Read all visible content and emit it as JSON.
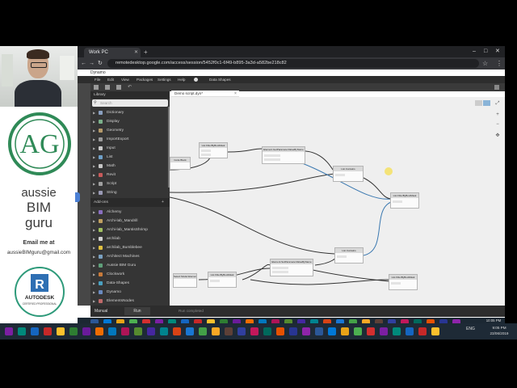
{
  "presenter": {
    "brand_line1": "aussie",
    "brand_line2": "BIM",
    "brand_line3": "guru",
    "email_label": "Email me at",
    "email": "aussieBIMguru@gmail.com",
    "logo_text": "AG",
    "badge_letter": "R",
    "badge_text1": "AUTODESK",
    "badge_text2": "CERTIFIED PROFESSIONAL"
  },
  "browser": {
    "tab_title": "Work PC",
    "url": "remotedesktop.google.com/access/session/5452f0c1-6f49-b895-3a3d-a582be218c82",
    "new_tab_symbol": "+",
    "minimize_symbol": "–",
    "maximize_symbol": "□",
    "close_symbol": "✕"
  },
  "dynamo": {
    "title": "Dynamo",
    "menu": [
      "File",
      "Edit",
      "View",
      "Packages",
      "Settings",
      "Help",
      "Data Shapes"
    ],
    "library_title": "Library",
    "workspace_tab": "Demo script.dyn*",
    "search_placeholder": "Search",
    "library_items": [
      {
        "label": "Dictionary",
        "color": "#8aa0c0"
      },
      {
        "label": "Display",
        "color": "#7bb08a"
      },
      {
        "label": "Geometry",
        "color": "#b59a6a"
      },
      {
        "label": "ImportExport",
        "color": "#9a9a9a"
      },
      {
        "label": "Input",
        "color": "#c9c9c9"
      },
      {
        "label": "List",
        "color": "#6fa0c8"
      },
      {
        "label": "Math",
        "color": "#c6c6c6"
      },
      {
        "label": "Revit",
        "color": "#c85a5a"
      },
      {
        "label": "Script",
        "color": "#a0a0a0"
      },
      {
        "label": "String",
        "color": "#9a9ab5"
      }
    ],
    "addons_label": "Add-ons",
    "addons_plus": "+",
    "package_items": [
      {
        "label": "Alchemy",
        "color": "#8a6fc0"
      },
      {
        "label": "Archi-lab_Mandrill",
        "color": "#c0a060"
      },
      {
        "label": "Archi-lab_MantisShrimp",
        "color": "#a0c060"
      },
      {
        "label": "archilab",
        "color": "#d0d0d0"
      },
      {
        "label": "archilab_Bumblebee",
        "color": "#e0c040"
      },
      {
        "label": "Architect Machines",
        "color": "#7aa0c0"
      },
      {
        "label": "Aussie BIM Guru",
        "color": "#5fa07a"
      },
      {
        "label": "Clockwork",
        "color": "#c87a3a"
      },
      {
        "label": "Data-Shapes",
        "color": "#4aa0c0"
      },
      {
        "label": "Dynamo",
        "color": "#6a8ac0"
      },
      {
        "label": "ElementsNodes",
        "color": "#c06a6a"
      }
    ],
    "nodes": [
      {
        "title": "Code Block"
      },
      {
        "title": "List.FilterByBoolMask"
      },
      {
        "title": "Element.GetParameterValueByName"
      },
      {
        "title": "List.Contains"
      },
      {
        "title": "List.FilterByBoolMask"
      },
      {
        "title": "Element.SetParameterValueByName"
      },
      {
        "title": "List.Contains"
      },
      {
        "title": "Select Model Element"
      },
      {
        "title": "List.FilterByBoolMask"
      },
      {
        "title": "List.FilterByBoolMask"
      }
    ],
    "zoom_fit": "⤢",
    "zoom_in": "+",
    "zoom_out": "−",
    "run_mode": "Manual",
    "run_label": "Run",
    "run_status": "Run completed"
  },
  "taskbar": {
    "time": "10:05 PM",
    "date": "23/06/2019",
    "time2": "9:05 PM",
    "date2": "23/06/2019",
    "language": "ENG"
  }
}
